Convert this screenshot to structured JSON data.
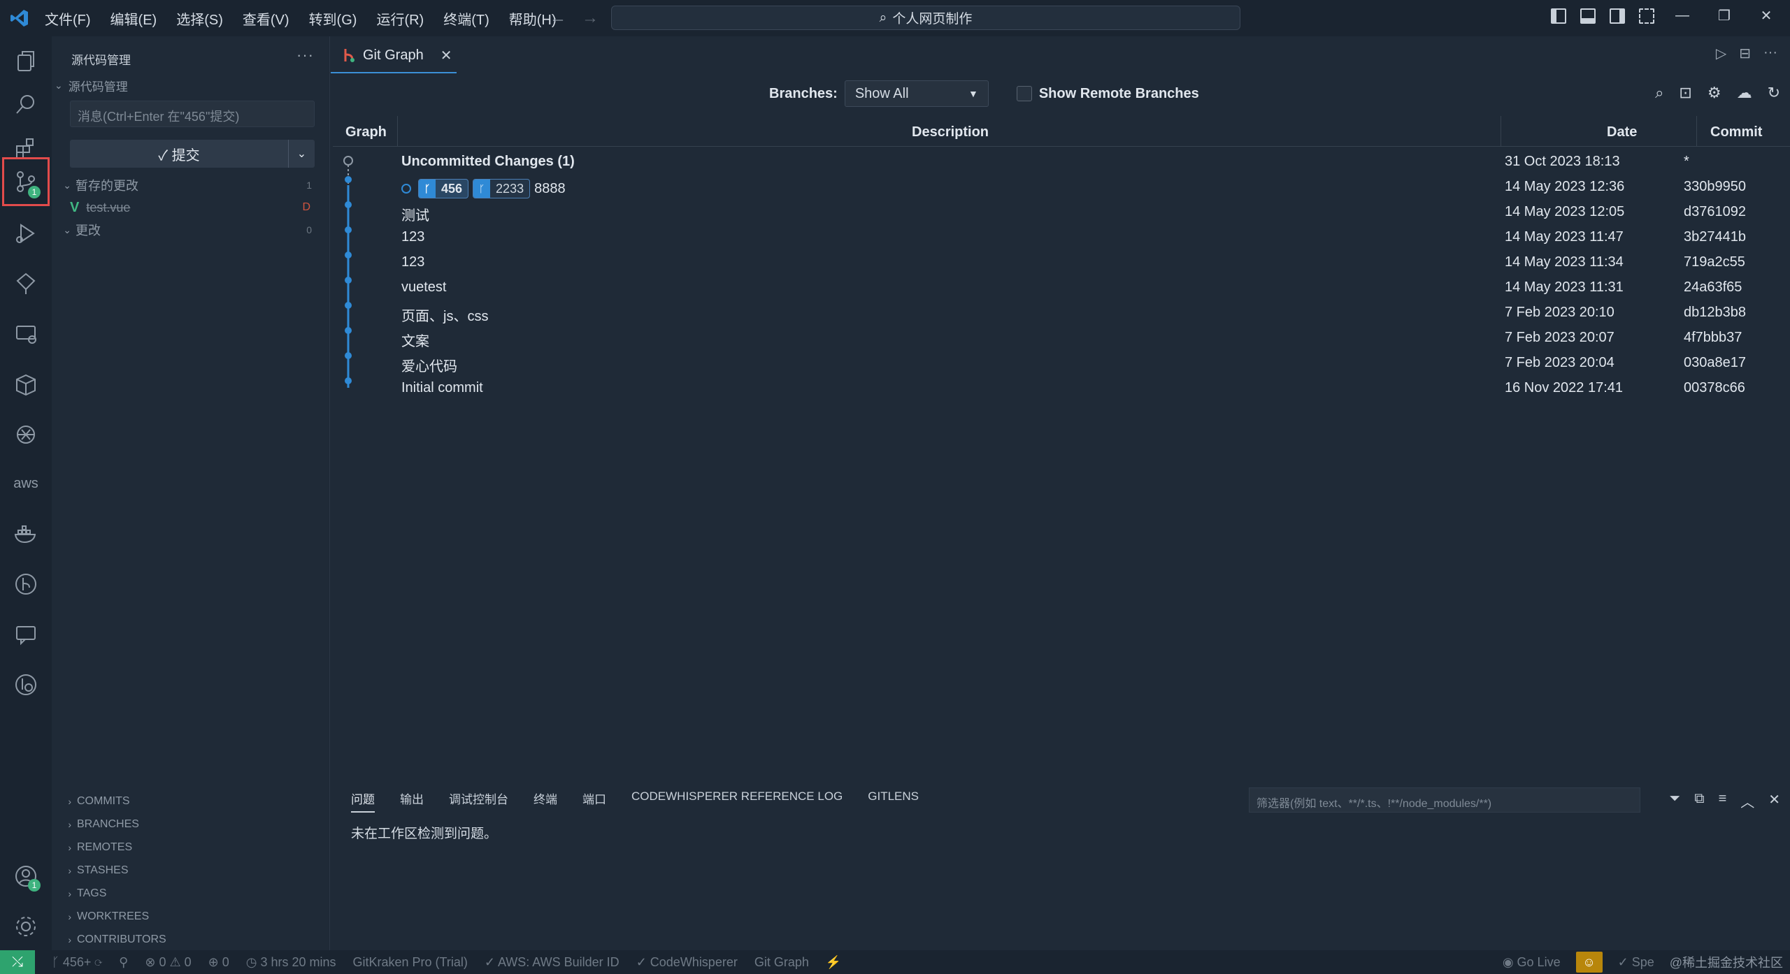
{
  "window": {
    "title": "个人网页制作",
    "menu": [
      "文件(F)",
      "编辑(E)",
      "选择(S)",
      "查看(V)",
      "转到(G)",
      "运行(R)",
      "终端(T)",
      "帮助(H)"
    ]
  },
  "activity": {
    "scm_badge": "1",
    "account_badge": "1"
  },
  "sidebar": {
    "title": "源代码管理",
    "section": "源代码管理",
    "message_placeholder": "消息(Ctrl+Enter 在\"456\"提交)",
    "commit_label": "✓ 提交",
    "staged_label": "暂存的更改",
    "staged_count": "1",
    "staged_file": "test.vue",
    "staged_file_status": "D",
    "changes_label": "更改",
    "changes_count": "0",
    "gitlens": [
      "COMMITS",
      "BRANCHES",
      "REMOTES",
      "STASHES",
      "TAGS",
      "WORKTREES",
      "CONTRIBUTORS"
    ]
  },
  "editor": {
    "tab_label": "Git Graph",
    "branches_label": "Branches:",
    "branch_value": "Show All",
    "remote_label": "Show Remote Branches",
    "columns": {
      "graph": "Graph",
      "description": "Description",
      "date": "Date",
      "commit": "Commit"
    },
    "rows": [
      {
        "desc": "Uncommitted Changes (1)",
        "date": "31 Oct 2023 18:13",
        "hash": "*"
      },
      {
        "desc": "8888",
        "date": "14 May 2023 12:36",
        "hash": "330b9950",
        "ref_head": "456",
        "ref_other": "2233"
      },
      {
        "desc": "测试",
        "date": "14 May 2023 12:05",
        "hash": "d3761092"
      },
      {
        "desc": "123",
        "date": "14 May 2023 11:47",
        "hash": "3b27441b"
      },
      {
        "desc": "123",
        "date": "14 May 2023 11:34",
        "hash": "719a2c55"
      },
      {
        "desc": "vuetest",
        "date": "14 May 2023 11:31",
        "hash": "24a63f65"
      },
      {
        "desc": "页面、js、css",
        "date": "7 Feb 2023 20:10",
        "hash": "db12b3b8"
      },
      {
        "desc": "文案",
        "date": "7 Feb 2023 20:07",
        "hash": "4f7bbb37"
      },
      {
        "desc": "爱心代码",
        "date": "7 Feb 2023 20:04",
        "hash": "030a8e17"
      },
      {
        "desc": "Initial commit",
        "date": "16 Nov 2022 17:41",
        "hash": "00378c66"
      }
    ]
  },
  "panel": {
    "tabs": [
      "问题",
      "输出",
      "调试控制台",
      "终端",
      "端口",
      "CODEWHISPERER REFERENCE LOG",
      "GITLENS"
    ],
    "filter_placeholder": "筛选器(例如 text、**/*.ts、!**/node_modules/**)",
    "message": "未在工作区检测到问题。"
  },
  "status": {
    "branch": "456+",
    "problems": "0",
    "warnings": "0",
    "ports": "0",
    "time": "3 hrs 20 mins",
    "gitkraken": "GitKraken Pro (Trial)",
    "aws": "AWS: AWS Builder ID",
    "codewhisperer": "CodeWhisperer",
    "gitgraph": "Git Graph",
    "golive": "Go Live",
    "spell": "Spe",
    "watermark": "@稀土掘金技术社区"
  },
  "colors": {
    "graph_line": "#2f8ad6",
    "accent": "#3b8fd6",
    "remote_green": "#2ea36e"
  }
}
